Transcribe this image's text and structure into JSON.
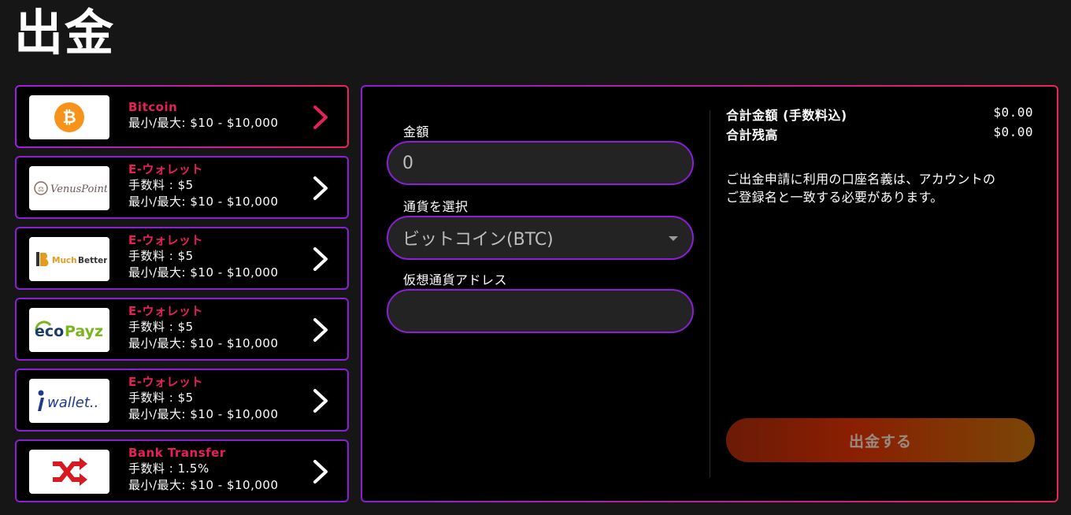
{
  "page": {
    "title": "出金"
  },
  "methods": [
    {
      "name": "Bitcoin",
      "fee": "",
      "limit": "最小/最大: $10 - $10,000",
      "logo": "bitcoin-logo",
      "active": true
    },
    {
      "name": "E-ウォレット",
      "fee": "手数料 : $5",
      "limit": "最小/最大: $10 - $10,000",
      "logo": "venuspoint-logo",
      "logo_text": "VenusPoint"
    },
    {
      "name": "E-ウォレット",
      "fee": "手数料 : $5",
      "limit": "最小/最大: $10 - $10,000",
      "logo": "muchbetter-logo",
      "logo_text": "MuchBetter"
    },
    {
      "name": "E-ウォレット",
      "fee": "手数料 : $5",
      "limit": "最小/最大: $10 - $10,000",
      "logo": "ecopayz-logo",
      "logo_text": "ecoPayz"
    },
    {
      "name": "E-ウォレット",
      "fee": "手数料 : $5",
      "limit": "最小/最大: $10 - $10,000",
      "logo": "iwallet-logo",
      "logo_text": "wallet.."
    },
    {
      "name": "Bank Transfer",
      "fee": "手数料 : 1.5%",
      "limit": "最小/最大: $10 - $10,000",
      "logo": "bank-transfer-shuffle-logo"
    }
  ],
  "form": {
    "amount_label": "金額",
    "amount_value": "0",
    "currency_label": "通貨を選択",
    "currency_value": "ビットコイン(BTC)",
    "address_label": "仮想通貨アドレス",
    "address_value": ""
  },
  "summary": {
    "total_label": "合計金額 (手数料込)",
    "total_value": "$0.00",
    "balance_label": "合計残高",
    "balance_value": "$0.00",
    "notice_line1": "ご出金申請に利用の口座名義は、アカウントの",
    "notice_line2": "ご登録名と一致する必要があります。",
    "submit_label": "出金する"
  },
  "colors": {
    "accent_pink": "#e8205a",
    "accent_purple": "#8a1fd6",
    "background": "#161616"
  }
}
